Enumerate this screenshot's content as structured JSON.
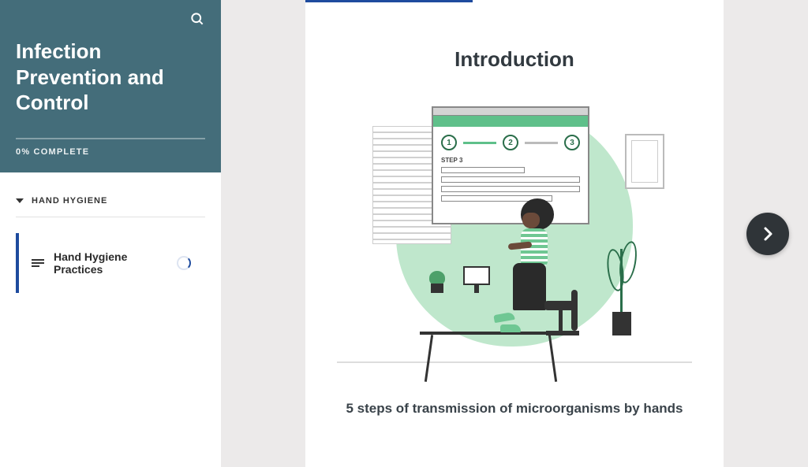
{
  "sidebar": {
    "course_title": "Infection Prevention and Control",
    "progress_percent": "0% COMPLETE",
    "sections": [
      {
        "title": "HAND HYGIENE",
        "lessons": [
          {
            "label": "Hand Hygiene Practices",
            "status": "in-progress"
          }
        ]
      }
    ]
  },
  "content": {
    "heading": "Introduction",
    "illustration": {
      "board_step_label": "STEP 3",
      "steps": [
        "1",
        "2",
        "3"
      ]
    },
    "subtitle": "5 steps of transmission of microorganisms by hands"
  },
  "icons": {
    "search": "search-icon",
    "next": "chevron-right-icon"
  }
}
